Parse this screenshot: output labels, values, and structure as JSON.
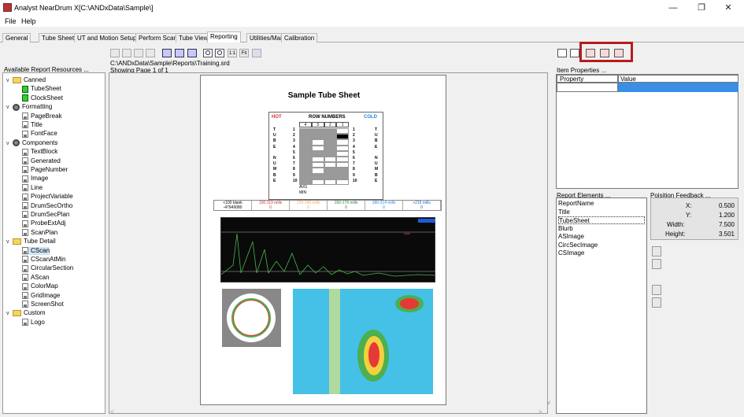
{
  "window": {
    "title": "Analyst NearDrum X[C:\\ANDxData\\Sample\\]",
    "minimize": "—",
    "maximize": "❐",
    "close": "✕"
  },
  "menubar": {
    "items": [
      "File",
      "Help"
    ]
  },
  "tabs": [
    "General",
    "Tube Sheet",
    "UT and Motion Setup",
    "Perform Scan",
    "Tube View",
    "Reporting",
    "Utilities/Maint",
    "Calibration"
  ],
  "active_tab": "Reporting",
  "left_panel": {
    "header": "Available Report Resources ...",
    "groups": [
      {
        "name": "Canned",
        "items": [
          "TubeSheet",
          "ClockSheet"
        ]
      },
      {
        "name": "Formatting",
        "items": [
          "PageBreak",
          "Title",
          "FontFace"
        ]
      },
      {
        "name": "Components",
        "items": [
          "TextBlock",
          "Generated",
          "PageNumber",
          "Image",
          "Line",
          "ProjectVariable",
          "DrumSecOrtho",
          "DrumSecPlan",
          "ProbeExtAdj",
          "ScanPlan"
        ]
      },
      {
        "name": "Tube Detail",
        "items": [
          "CScan",
          "CScanAtMin",
          "CircularSection",
          "AScan",
          "ColorMap",
          "GridImage",
          "ScreenShot"
        ]
      },
      {
        "name": "Custom",
        "items": [
          "Logo"
        ]
      }
    ]
  },
  "center": {
    "path": "C:\\ANDxData\\Sample\\Reports\\Training.srd",
    "page_info": "Showing Page 1 of 1",
    "zoom_1to1": "1:1",
    "zoom_fit": "Fit"
  },
  "report": {
    "title": "Sample Tube Sheet",
    "hot": "HOT",
    "cold": "COLD",
    "row_numbers": "ROW NUMBERS",
    "col_headers": [
      "4",
      "3",
      "2",
      "1"
    ],
    "left_letters": [
      "T",
      "U",
      "B",
      "E",
      "",
      "N",
      "U",
      "M",
      "B",
      "E"
    ],
    "right_letters": [
      "T",
      "U",
      "B",
      "E",
      "",
      "N",
      "U",
      "M",
      "B",
      "E"
    ],
    "row_numbers_list": [
      "1",
      "2",
      "3",
      "4",
      "5",
      "6",
      "7",
      "8",
      "9",
      "10"
    ],
    "avg": "AVG",
    "min": "MIN",
    "legend": [
      "<100 blank",
      "100-119 mills",
      "120-149 mills",
      "150-179 mills",
      "180-214 mills",
      ">215 mills"
    ],
    "legend_values": [
      "-47949080",
      "0",
      "0",
      "0",
      "0",
      "0"
    ],
    "legend_colors": [
      "#000000",
      "#d32f2f",
      "#f4a460",
      "#2e7d32",
      "#1e88e5",
      "#1565c0"
    ]
  },
  "right_panel": {
    "item_properties_header": "Item Properties ...",
    "property_col": "Property",
    "value_col": "Value",
    "report_elements_header": "Report Elements ...",
    "report_elements": [
      "ReportName",
      "Title",
      "TubeSheet",
      "Blurb",
      "ASImage",
      "CircSecImage",
      "CSImage"
    ],
    "selected_element": "TubeSheet",
    "position_header": "Poisition Feedback ...",
    "position": [
      {
        "label": "X:",
        "value": "0.500"
      },
      {
        "label": "Y:",
        "value": "1.200"
      },
      {
        "label": "Width:",
        "value": "7.500"
      },
      {
        "label": "Height:",
        "value": "3.501"
      }
    ]
  },
  "colors": {
    "highlight": "#b71c1c",
    "selection": "#3a8ee6"
  }
}
